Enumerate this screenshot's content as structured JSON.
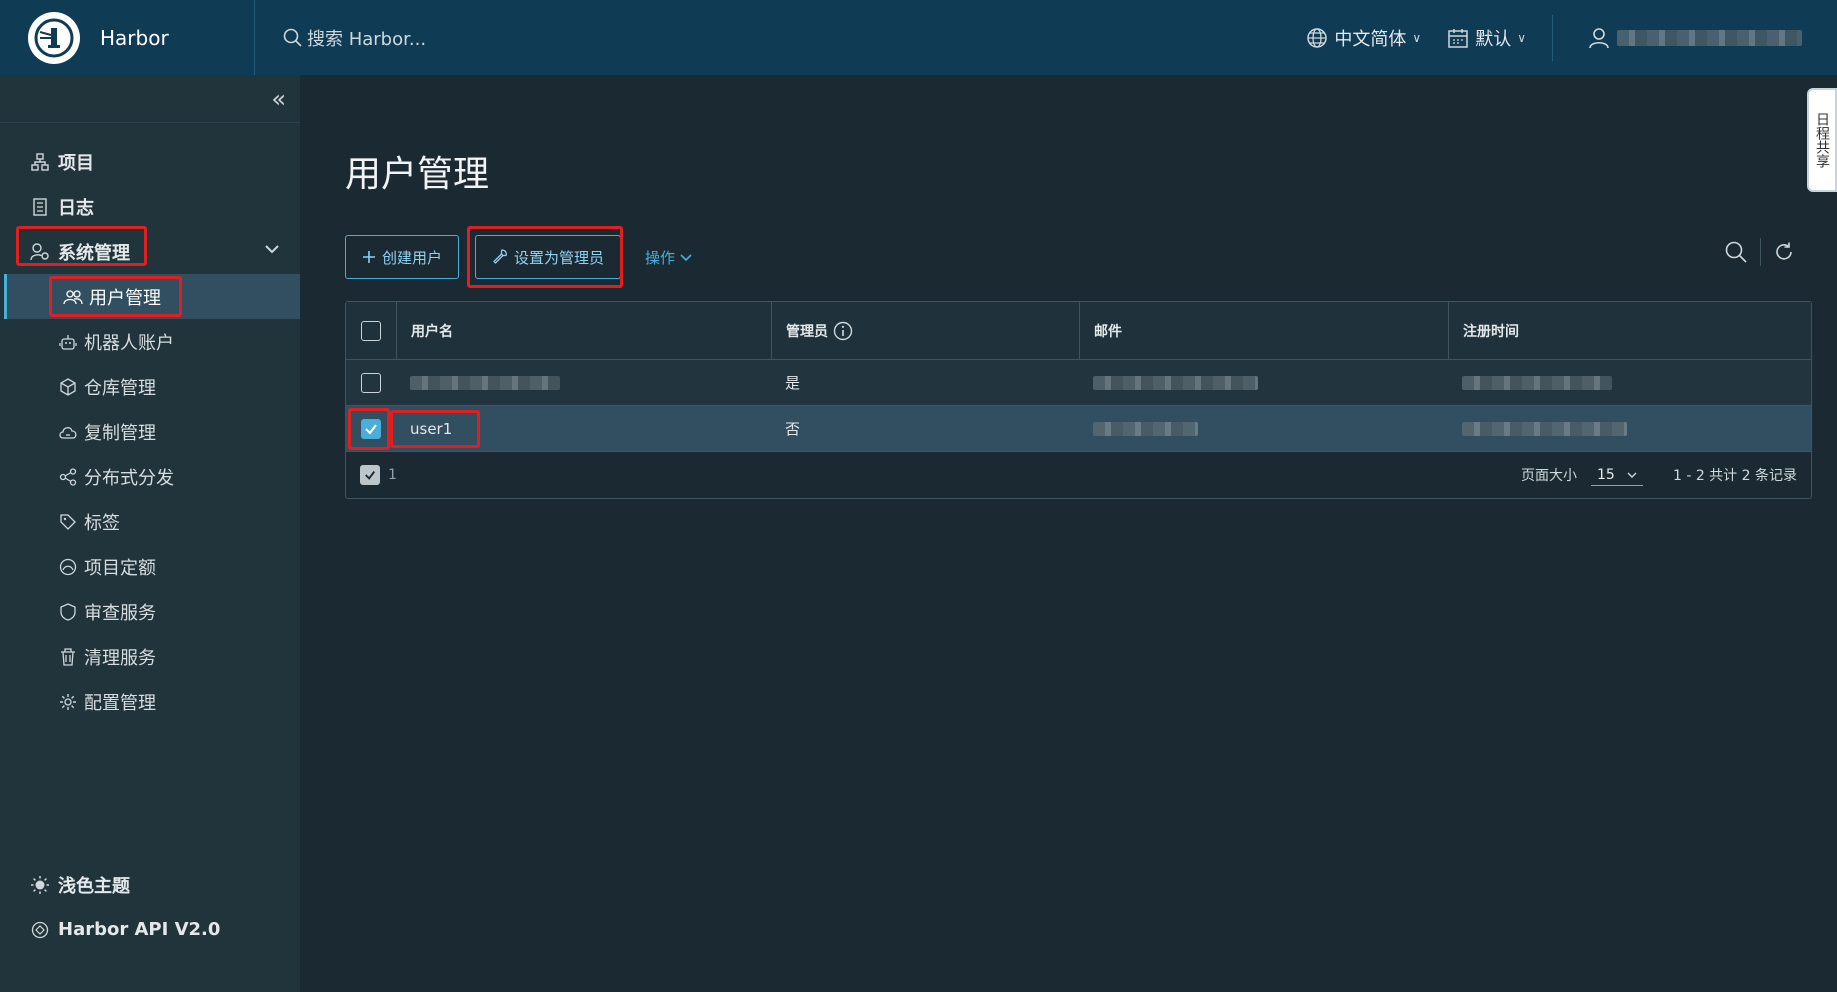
{
  "header": {
    "brand": "Harbor",
    "search_placeholder": "搜索 Harbor...",
    "language": "中文简体",
    "datetime_format": "默认"
  },
  "sidebar": {
    "items": [
      {
        "label": "项目",
        "icon": "projects-icon"
      },
      {
        "label": "日志",
        "icon": "logs-icon"
      },
      {
        "label": "系统管理",
        "icon": "admin-icon"
      }
    ],
    "subitems": [
      {
        "label": "用户管理",
        "icon": "users-icon",
        "active": true
      },
      {
        "label": "机器人账户",
        "icon": "robot-icon"
      },
      {
        "label": "仓库管理",
        "icon": "registry-icon"
      },
      {
        "label": "复制管理",
        "icon": "replication-icon"
      },
      {
        "label": "分布式分发",
        "icon": "distribution-icon"
      },
      {
        "label": "标签",
        "icon": "tag-icon"
      },
      {
        "label": "项目定额",
        "icon": "quota-icon"
      },
      {
        "label": "审查服务",
        "icon": "shield-icon"
      },
      {
        "label": "清理服务",
        "icon": "trash-icon"
      },
      {
        "label": "配置管理",
        "icon": "gear-icon"
      }
    ],
    "bottom": {
      "theme": "浅色主题",
      "api": "Harbor API V2.0"
    }
  },
  "main": {
    "title": "用户管理",
    "buttons": {
      "create_user": "创建用户",
      "set_admin": "设置为管理员",
      "actions": "操作"
    },
    "table": {
      "columns": [
        "用户名",
        "管理员",
        "邮件",
        "注册时间"
      ],
      "rows": [
        {
          "username": "",
          "admin": "是",
          "email": "",
          "created": "",
          "selected": false
        },
        {
          "username": "user1",
          "admin": "否",
          "email": "",
          "created": "",
          "selected": true
        }
      ],
      "selected_count": "1",
      "page_size_label": "页面大小",
      "page_size": "15",
      "summary": "1 - 2 共计 2 条记录"
    }
  },
  "notice_tab": "日程共享",
  "colors": {
    "header_bg": "#0f3b55",
    "sidebar_bg": "#21333b",
    "main_bg": "#1b2a32",
    "accent": "#49afd9",
    "highlight_red": "#e02020"
  }
}
